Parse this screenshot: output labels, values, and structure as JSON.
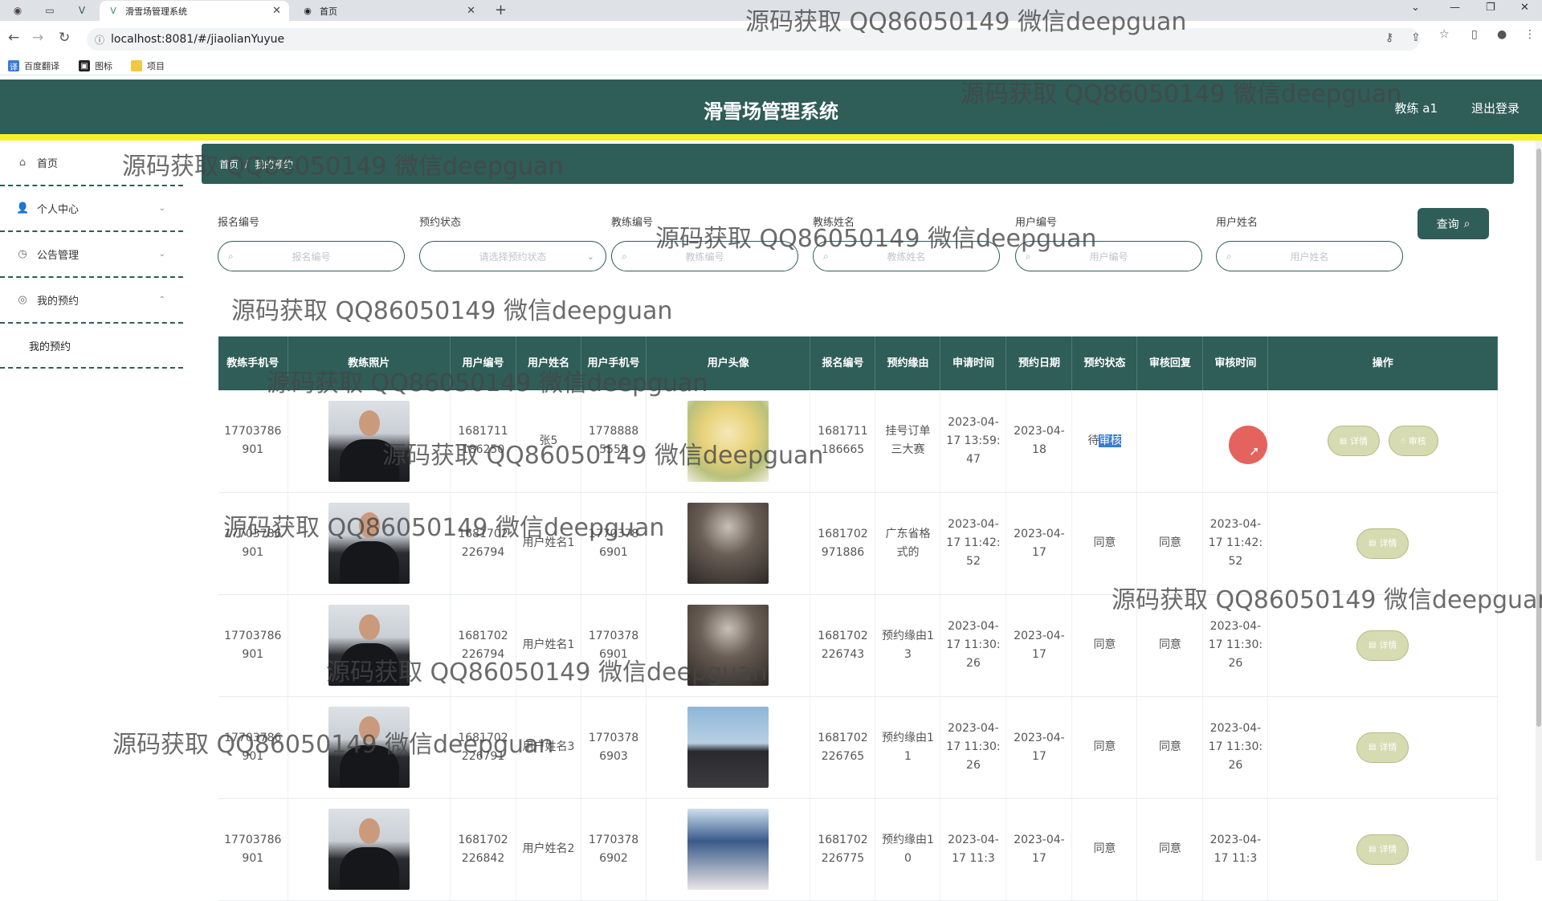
{
  "browser": {
    "tabs": [
      {
        "title": "滑雪场管理系统",
        "active": true
      },
      {
        "title": "首页",
        "active": false
      }
    ],
    "url": "localhost:8081/#/jiaolianYuyue",
    "bookmarks": [
      "百度翻译",
      "图标",
      "项目"
    ]
  },
  "header": {
    "title": "滑雪场管理系统",
    "user": "教练 a1",
    "logout": "退出登录"
  },
  "sidebar": {
    "items": [
      {
        "label": "首页",
        "icon": "home-icon"
      },
      {
        "label": "个人中心",
        "icon": "user-icon"
      },
      {
        "label": "公告管理",
        "icon": "clock-icon"
      },
      {
        "label": "我的预约",
        "icon": "compass-icon"
      }
    ],
    "sub_items": [
      "我的预约"
    ]
  },
  "breadcrumb": {
    "home": "首页",
    "current": "我的预约"
  },
  "search": {
    "fields": [
      {
        "label": "报名编号",
        "placeholder": "报名编号"
      },
      {
        "label": "预约状态",
        "placeholder": "请选择预约状态"
      },
      {
        "label": "教练编号",
        "placeholder": "教练编号"
      },
      {
        "label": "教练姓名",
        "placeholder": "教练姓名"
      },
      {
        "label": "用户编号",
        "placeholder": "用户编号"
      },
      {
        "label": "用户姓名",
        "placeholder": "用户姓名"
      }
    ],
    "query_label": "查询"
  },
  "table": {
    "columns": [
      "教练手机号",
      "教练照片",
      "用户编号",
      "用户姓名",
      "用户手机号",
      "用户头像",
      "报名编号",
      "预约缘由",
      "申请时间",
      "预约日期",
      "预约状态",
      "审核回复",
      "审核时间",
      "操作"
    ],
    "rows": [
      {
        "coach_phone": "17703786901",
        "user_no": "1681711186250",
        "user_name": "张5",
        "user_phone": "17788885555",
        "order_no": "1681711186665",
        "reason": "挂号订单三大赛",
        "apply_time": "2023-04-17 13:59:47",
        "date": "2023-04-18",
        "status_a": "待",
        "status_b": "审核",
        "reply": "",
        "audit_time": "",
        "actions": [
          "详情",
          "审核"
        ]
      },
      {
        "coach_phone": "17703786901",
        "user_no": "1681702226794",
        "user_name": "用户姓名1",
        "user_phone": "17703786901",
        "order_no": "1681702971886",
        "reason": "广东省格式的",
        "apply_time": "2023-04-17 11:42:52",
        "date": "2023-04-17",
        "status_a": "同意",
        "status_b": "",
        "reply": "同意",
        "audit_time": "2023-04-17 11:42:52",
        "actions": [
          "详情"
        ]
      },
      {
        "coach_phone": "17703786901",
        "user_no": "1681702226794",
        "user_name": "用户姓名1",
        "user_phone": "17703786901",
        "order_no": "1681702226743",
        "reason": "预约缘由13",
        "apply_time": "2023-04-17 11:30:26",
        "date": "2023-04-17",
        "status_a": "同意",
        "status_b": "",
        "reply": "同意",
        "audit_time": "2023-04-17 11:30:26",
        "actions": [
          "详情"
        ]
      },
      {
        "coach_phone": "17703786901",
        "user_no": "1681702226791",
        "user_name": "用户姓名3",
        "user_phone": "17703786903",
        "order_no": "1681702226765",
        "reason": "预约缘由11",
        "apply_time": "2023-04-17 11:30:26",
        "date": "2023-04-17",
        "status_a": "同意",
        "status_b": "",
        "reply": "同意",
        "audit_time": "2023-04-17 11:30:26",
        "actions": [
          "详情"
        ]
      },
      {
        "coach_phone": "17703786901",
        "user_no": "1681702226842",
        "user_name": "用户姓名2",
        "user_phone": "17703786902",
        "order_no": "1681702226775",
        "reason": "预约缘由10",
        "apply_time": "2023-04-17 11:3",
        "date": "2023-04-17",
        "status_a": "同意",
        "status_b": "",
        "reply": "同意",
        "audit_time": "2023-04-17 11:3",
        "actions": [
          "详情"
        ]
      }
    ]
  },
  "watermark": "源码获取 QQ86050149 微信deepguan",
  "colors": {
    "primary": "#2f5d58",
    "accent_bar": "#f5f02a",
    "pill": "#d7dbb1",
    "cursor": "#e2524d"
  }
}
